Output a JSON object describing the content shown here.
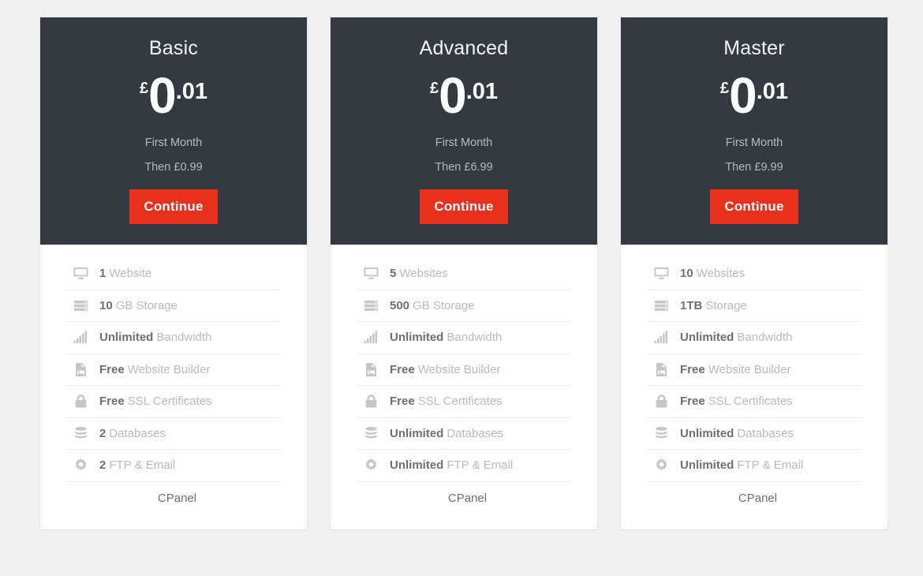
{
  "theme": {
    "page_background": "#f0f0f1",
    "header_background": "#343a40",
    "card_background": "#ffffff",
    "accent_button": "#e8301d",
    "value_text": "#6c7074",
    "label_text": "#b9babc"
  },
  "plans": [
    {
      "name": "Basic",
      "price": {
        "currency": "£",
        "whole": "0",
        "decimal": ".01"
      },
      "period": "First Month",
      "renewal": "Then £0.99",
      "cta": "Continue",
      "features": [
        {
          "icon": "monitor-icon",
          "value": "1",
          "label": "Website"
        },
        {
          "icon": "server-icon",
          "value": "10",
          "label": "GB Storage"
        },
        {
          "icon": "signal-bars-icon",
          "value": "Unlimited",
          "label": "Bandwidth"
        },
        {
          "icon": "document-image-icon",
          "value": "Free",
          "label": "Website Builder"
        },
        {
          "icon": "lock-icon",
          "value": "Free",
          "label": "SSL Certificates"
        },
        {
          "icon": "database-icon",
          "value": "2",
          "label": "Databases"
        },
        {
          "icon": "gear-icon",
          "value": "2",
          "label": "FTP & Email"
        }
      ],
      "footer": "CPanel"
    },
    {
      "name": "Advanced",
      "price": {
        "currency": "£",
        "whole": "0",
        "decimal": ".01"
      },
      "period": "First Month",
      "renewal": "Then £6.99",
      "cta": "Continue",
      "features": [
        {
          "icon": "monitor-icon",
          "value": "5",
          "label": "Websites"
        },
        {
          "icon": "server-icon",
          "value": "500",
          "label": "GB Storage"
        },
        {
          "icon": "signal-bars-icon",
          "value": "Unlimited",
          "label": "Bandwidth"
        },
        {
          "icon": "document-image-icon",
          "value": "Free",
          "label": "Website Builder"
        },
        {
          "icon": "lock-icon",
          "value": "Free",
          "label": "SSL Certificates"
        },
        {
          "icon": "database-icon",
          "value": "Unlimited",
          "label": "Databases"
        },
        {
          "icon": "gear-icon",
          "value": "Unlimited",
          "label": "FTP & Email"
        }
      ],
      "footer": "CPanel"
    },
    {
      "name": "Master",
      "price": {
        "currency": "£",
        "whole": "0",
        "decimal": ".01"
      },
      "period": "First Month",
      "renewal": "Then £9.99",
      "cta": "Continue",
      "features": [
        {
          "icon": "monitor-icon",
          "value": "10",
          "label": "Websites"
        },
        {
          "icon": "server-icon",
          "value": "1TB",
          "label": "Storage"
        },
        {
          "icon": "signal-bars-icon",
          "value": "Unlimited",
          "label": "Bandwidth"
        },
        {
          "icon": "document-image-icon",
          "value": "Free",
          "label": "Website Builder"
        },
        {
          "icon": "lock-icon",
          "value": "Free",
          "label": "SSL Certificates"
        },
        {
          "icon": "database-icon",
          "value": "Unlimited",
          "label": "Databases"
        },
        {
          "icon": "gear-icon",
          "value": "Unlimited",
          "label": "FTP & Email"
        }
      ],
      "footer": "CPanel"
    }
  ]
}
